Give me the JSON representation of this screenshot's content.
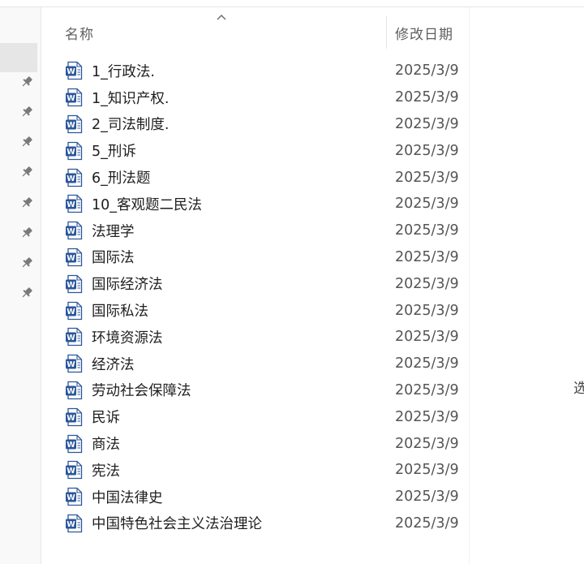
{
  "columns": {
    "name": "名称",
    "date_modified": "修改日期"
  },
  "sort_icon": "chevron-up-icon",
  "file_icon": "word-document-icon",
  "pin_icon": "pin-icon",
  "colors": {
    "word_blue": "#2b579a",
    "selection": "#e6e6e6"
  },
  "files": [
    {
      "name": "1_行政法.",
      "date": "2025/3/9"
    },
    {
      "name": "1_知识产权.",
      "date": "2025/3/9"
    },
    {
      "name": "2_司法制度.",
      "date": "2025/3/9"
    },
    {
      "name": "5_刑诉",
      "date": "2025/3/9"
    },
    {
      "name": "6_刑法题",
      "date": "2025/3/9"
    },
    {
      "name": "10_客观题二民法",
      "date": "2025/3/9"
    },
    {
      "name": "法理学",
      "date": "2025/3/9"
    },
    {
      "name": "国际法",
      "date": "2025/3/9"
    },
    {
      "name": "国际经济法",
      "date": "2025/3/9"
    },
    {
      "name": "国际私法",
      "date": "2025/3/9"
    },
    {
      "name": "环境资源法",
      "date": "2025/3/9"
    },
    {
      "name": "经济法",
      "date": "2025/3/9"
    },
    {
      "name": "劳动社会保障法",
      "date": "2025/3/9"
    },
    {
      "name": "民诉",
      "date": "2025/3/9"
    },
    {
      "name": "商法",
      "date": "2025/3/9"
    },
    {
      "name": "宪法",
      "date": "2025/3/9"
    },
    {
      "name": "中国法律史",
      "date": "2025/3/9"
    },
    {
      "name": "中国特色社会主义法治理论",
      "date": "2025/3/9"
    }
  ],
  "edge_text": "选"
}
